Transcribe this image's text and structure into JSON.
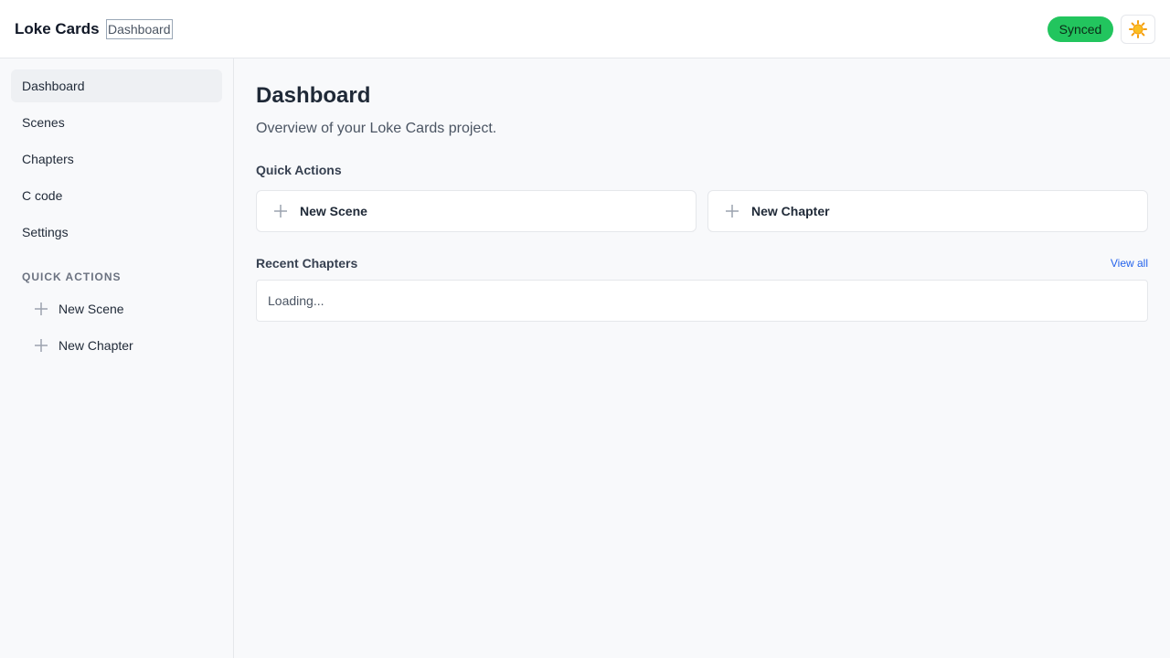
{
  "app": {
    "title": "Loke Cards"
  },
  "header": {
    "breadcrumb": "Dashboard",
    "sync_status": "Synced",
    "theme_icon": "sun-icon",
    "colors": {
      "sync": "#22c55e"
    }
  },
  "sidebar": {
    "items": [
      {
        "label": "Dashboard",
        "active": true
      },
      {
        "label": "Scenes"
      },
      {
        "label": "Chapters"
      },
      {
        "label": "C code"
      },
      {
        "label": "Settings"
      }
    ],
    "quick_actions_label": "QUICK ACTIONS",
    "quick_actions": [
      {
        "label": "New Scene",
        "icon": "plus-icon"
      },
      {
        "label": "New Chapter",
        "icon": "plus-icon"
      }
    ]
  },
  "main": {
    "title": "Dashboard",
    "subtitle": "Overview of your Loke Cards project.",
    "quick_actions_heading": "Quick Actions",
    "quick_actions": [
      {
        "label": "New Scene",
        "icon": "plus-icon"
      },
      {
        "label": "New Chapter",
        "icon": "plus-icon"
      }
    ],
    "recent_heading": "Recent Chapters",
    "view_all": "View all",
    "recent_status": "Loading..."
  },
  "colors": {
    "link": "#2563eb",
    "active_nav_bg": "#eef0f3"
  }
}
